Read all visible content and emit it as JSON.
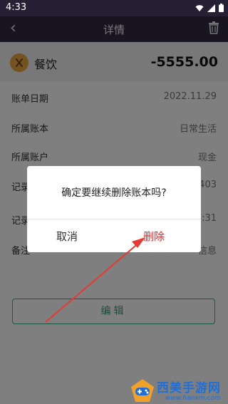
{
  "status": {
    "time": "4:33"
  },
  "header": {
    "title": "详情"
  },
  "record": {
    "category": "餐饮",
    "amount": "-5555.00"
  },
  "fields": [
    {
      "label": "账单日期",
      "value": "2022.11.29"
    },
    {
      "label": "所属账本",
      "value": "日常生活"
    },
    {
      "label": "所属账户",
      "value": "现金"
    },
    {
      "label": "记录",
      "value": "403"
    },
    {
      "label": "记录",
      "value": "5:31"
    },
    {
      "label": "备注",
      "value": "信息"
    }
  ],
  "actions": {
    "edit_label": "编辑"
  },
  "dialog": {
    "message": "确定要继续删除账本吗?",
    "cancel_label": "取消",
    "confirm_label": "删除"
  },
  "watermark": {
    "text": "西美手游网",
    "url": "www.hanxm.com"
  },
  "colors": {
    "header_bg": "#302a40",
    "accent_green": "#34b07a",
    "delete_red": "#e02828",
    "arrow_red": "#e53935",
    "category_icon": "#e9a640"
  }
}
